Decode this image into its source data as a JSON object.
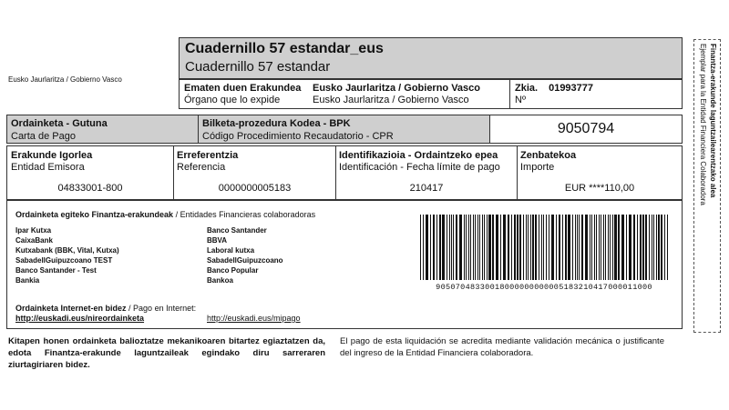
{
  "issuer_left": "Eusko Jaurlaritza / Gobierno Vasco",
  "title": {
    "eus": "Cuadernillo 57 estandar_eus",
    "es": "Cuadernillo 57 estandar"
  },
  "organ": {
    "label_eus": "Ematen duen Erakundea",
    "label_es": "Órgano que lo expide",
    "value_eus": "Eusko Jaurlaritza / Gobierno Vasco",
    "value_es": "Eusko Jaurlaritza / Gobierno Vasco",
    "zkia_label": "Zkia.",
    "zkia_value": "01993777",
    "no_label": "Nº"
  },
  "payment": {
    "type_eus": "Ordainketa - Gutuna",
    "type_es": "Carta de Pago",
    "proc_eus": "Bilketa-prozedura Kodea - BPK",
    "proc_es": "Código Procedimiento Recaudatorio - CPR",
    "code": "9050794"
  },
  "fields": {
    "entity_eus": "Erakunde Igorlea",
    "entity_es": "Entidad Emisora",
    "entity_value": "04833001-800",
    "ref_eus": "Erreferentzia",
    "ref_es": "Referencia",
    "ref_value": "0000000005183",
    "ident_eus": "Identifikazioia - Ordaintzeko epea",
    "ident_es": "Identificación - Fecha límite de pago",
    "ident_value": "210417",
    "amount_eus": "Zenbatekoa",
    "amount_es": "Importe",
    "amount_value": "EUR ****110,00"
  },
  "banks": {
    "heading_eus": "Ordainketa egiteko Finantza-erakundeak",
    "heading_sep": " / ",
    "heading_es": "Entidades Financieras colaboradoras",
    "left": [
      "Ipar Kutxa",
      "CaixaBank",
      "Kutxabank (BBK, Vital, Kutxa)",
      "SabadellGuipuzcoano TEST",
      "Banco Santander - Test",
      "Bankia"
    ],
    "right": [
      "Banco Santander",
      "BBVA",
      "Laboral kutxa",
      "SabadellGuipuzcoano",
      "Banco Popular",
      "Bankoa"
    ]
  },
  "internet": {
    "heading_eus": "Ordainketa Internet-en bidez",
    "heading_sep": " / ",
    "heading_es": "Pago en Internet:",
    "link_eus": "http://euskadi.eus/nireordainketa",
    "link_es": "http://euskadi.eus/mipago"
  },
  "barcode_number": "90507048330018000000000005183210417000011000",
  "footer": {
    "eus": "Kitapen honen ordainketa balioztatze mekanikoaren bitartez egiaztatzen da, edota Finantza-erakunde laguntzaileak egindako diru sarreraren ziurtagiriaren bidez.",
    "es": "El pago de esta liquidación se acredita mediante validación mecánica o justificante del ingreso de la Entidad Financiera colaboradora."
  },
  "side": {
    "eus": "Finantza-erakunde laguntzailearentzako alea",
    "es": "Ejemplar para la Entidad Financiera Colaboradora"
  }
}
